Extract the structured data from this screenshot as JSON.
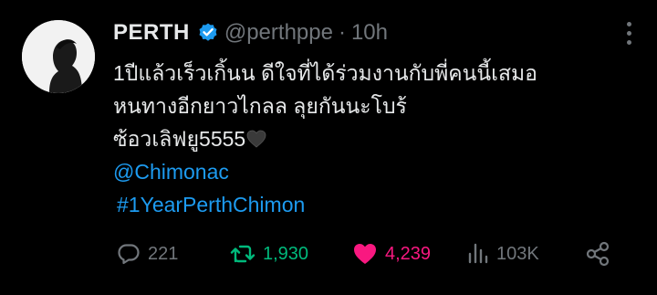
{
  "author": {
    "name": "PERTH",
    "handle": "@perthppe",
    "separator": "·",
    "time": "10h"
  },
  "tweet": {
    "lines": [
      "1ปีแล้วเร็วเกิ้นน ดีใจที่ได้ร่วมงานกับพี่คนนี้เสมอ",
      "หนทางอีกยาวไกลล ลุยกันนะโบร้",
      "ซ้อวเลิฟยู5555"
    ],
    "mention": "@Chimonac",
    "hashtag": "#1YearPerthChimon"
  },
  "actions": {
    "replies": "221",
    "retweets": "1,930",
    "likes": "4,239",
    "views": "103K"
  },
  "icons": {
    "verified": "verified-badge-icon",
    "emoji": "black-heart-emoji",
    "reply": "reply-icon",
    "retweet": "retweet-icon",
    "like": "heart-icon",
    "views": "views-icon",
    "share": "share-icon",
    "more": "more-icon"
  },
  "colors": {
    "background": "#000000",
    "text": "#e7e9ea",
    "muted": "#71767b",
    "link": "#1d9bf0",
    "retweet": "#00ba7c",
    "like": "#f91880",
    "verified": "#1d9bf0"
  }
}
